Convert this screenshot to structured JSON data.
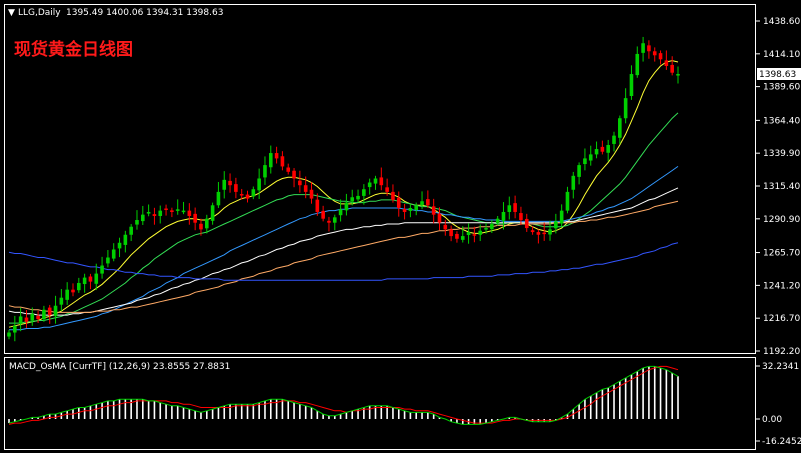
{
  "header": {
    "symbol": "LLG,Daily",
    "ohlc": "1395.49 1400.06 1394.31 1398.63",
    "overlay_title": "现货黄金日线图"
  },
  "macd": {
    "label": "MACD_OsMA [CurrTF] (12,26,9) 23.8555 27.8831",
    "max_label": "32.2341",
    "zero_label": "0.00",
    "min_label": "-16.2452"
  },
  "current_price_label": "1398.63",
  "colors": {
    "background": "#000000",
    "axis": "#ffffff",
    "bull": "#00d000",
    "bear": "#ff0000",
    "title_red": "#ff1a1a",
    "macd_line": "#00d000",
    "signal_line": "#ff0000"
  },
  "chart_data": [
    {
      "type": "candlestick",
      "title": "LLG,Daily",
      "ylim": [
        1192.2,
        1438.6
      ],
      "y_ticks": [
        1438.6,
        1414.1,
        1389.6,
        1364.4,
        1339.9,
        1315.4,
        1290.9,
        1265.7,
        1241.2,
        1216.7,
        1192.2
      ],
      "y_tick_labels": [
        "1438.60",
        "1414.10",
        "1389.60",
        "1364.40",
        "1339.90",
        "1315.40",
        "1290.90",
        "1265.70",
        "1241.20",
        "1216.70",
        "1192.20"
      ],
      "last_close": 1398.63,
      "closes": [
        1206,
        1211,
        1218,
        1214,
        1220,
        1216,
        1223,
        1219,
        1226,
        1232,
        1238,
        1236,
        1243,
        1247,
        1244,
        1250,
        1256,
        1262,
        1268,
        1273,
        1279,
        1285,
        1290,
        1294,
        1296,
        1293,
        1297,
        1298,
        1296,
        1298,
        1297,
        1293,
        1288,
        1283,
        1291,
        1301,
        1311,
        1320,
        1316,
        1311,
        1309,
        1306,
        1313,
        1321,
        1331,
        1340,
        1336,
        1330,
        1326,
        1321,
        1316,
        1311,
        1306,
        1296,
        1291,
        1288,
        1292,
        1298,
        1303,
        1307,
        1308,
        1313,
        1318,
        1321,
        1316,
        1311,
        1305,
        1299,
        1296,
        1299,
        1301,
        1304,
        1301,
        1294,
        1288,
        1283,
        1278,
        1276,
        1278,
        1281,
        1279,
        1282,
        1284,
        1287,
        1291,
        1296,
        1301,
        1296,
        1290,
        1284,
        1281,
        1279,
        1280,
        1283,
        1289,
        1297,
        1311,
        1323,
        1331,
        1336,
        1339,
        1343,
        1341,
        1346,
        1353,
        1366,
        1381,
        1399,
        1414,
        1422,
        1416,
        1413,
        1410,
        1405,
        1400,
        1399
      ],
      "series": [
        {
          "name": "",
          "color": "#ffff33",
          "values": [
            1210,
            1211,
            1212,
            1213,
            1214,
            1215,
            1217,
            1218,
            1220,
            1222,
            1225,
            1228,
            1231,
            1234,
            1236,
            1239,
            1242,
            1246,
            1250,
            1254,
            1259,
            1264,
            1268,
            1272,
            1276,
            1279,
            1282,
            1285,
            1287,
            1289,
            1290,
            1291,
            1291,
            1290,
            1290,
            1292,
            1295,
            1299,
            1302,
            1304,
            1306,
            1307,
            1308,
            1310,
            1313,
            1316,
            1319,
            1321,
            1322,
            1322,
            1321,
            1320,
            1318,
            1315,
            1311,
            1307,
            1304,
            1302,
            1302,
            1302,
            1303,
            1305,
            1307,
            1309,
            1310,
            1310,
            1309,
            1307,
            1304,
            1302,
            1301,
            1301,
            1300,
            1298,
            1295,
            1292,
            1288,
            1285,
            1283,
            1281,
            1280,
            1280,
            1281,
            1282,
            1283,
            1285,
            1287,
            1288,
            1288,
            1287,
            1285,
            1283,
            1282,
            1281,
            1282,
            1284,
            1288,
            1294,
            1301,
            1309,
            1316,
            1323,
            1328,
            1333,
            1339,
            1346,
            1354,
            1364,
            1374,
            1385,
            1394,
            1400,
            1405,
            1408,
            1409,
            1408
          ]
        },
        {
          "name": "",
          "color": "#33dd55",
          "values": [
            1213,
            1213,
            1213,
            1214,
            1214,
            1215,
            1215,
            1216,
            1217,
            1218,
            1220,
            1221,
            1223,
            1225,
            1227,
            1229,
            1231,
            1234,
            1237,
            1240,
            1243,
            1247,
            1250,
            1254,
            1257,
            1261,
            1264,
            1267,
            1270,
            1273,
            1275,
            1277,
            1279,
            1280,
            1281,
            1283,
            1285,
            1287,
            1289,
            1291,
            1293,
            1295,
            1297,
            1299,
            1301,
            1303,
            1305,
            1306,
            1308,
            1309,
            1309,
            1309,
            1309,
            1308,
            1307,
            1306,
            1305,
            1304,
            1304,
            1303,
            1303,
            1303,
            1304,
            1304,
            1305,
            1305,
            1305,
            1304,
            1303,
            1302,
            1301,
            1300,
            1300,
            1299,
            1298,
            1297,
            1295,
            1293,
            1292,
            1291,
            1290,
            1289,
            1288,
            1288,
            1287,
            1287,
            1288,
            1288,
            1288,
            1287,
            1287,
            1286,
            1285,
            1285,
            1285,
            1285,
            1286,
            1288,
            1291,
            1294,
            1297,
            1301,
            1305,
            1309,
            1313,
            1317,
            1322,
            1328,
            1334,
            1340,
            1346,
            1351,
            1356,
            1361,
            1366,
            1370
          ]
        },
        {
          "name": "",
          "color": "#3399ff",
          "values": [
            1208,
            1208,
            1208,
            1209,
            1209,
            1209,
            1210,
            1210,
            1211,
            1212,
            1213,
            1214,
            1215,
            1216,
            1217,
            1218,
            1220,
            1221,
            1223,
            1225,
            1227,
            1229,
            1231,
            1233,
            1236,
            1238,
            1240,
            1243,
            1245,
            1247,
            1250,
            1252,
            1254,
            1256,
            1258,
            1260,
            1262,
            1264,
            1267,
            1269,
            1271,
            1273,
            1275,
            1277,
            1279,
            1281,
            1283,
            1285,
            1287,
            1289,
            1291,
            1292,
            1294,
            1295,
            1296,
            1297,
            1297,
            1298,
            1298,
            1299,
            1299,
            1299,
            1299,
            1299,
            1299,
            1299,
            1299,
            1299,
            1298,
            1298,
            1297,
            1297,
            1296,
            1296,
            1295,
            1294,
            1294,
            1293,
            1292,
            1292,
            1291,
            1291,
            1290,
            1290,
            1290,
            1289,
            1289,
            1289,
            1289,
            1289,
            1289,
            1289,
            1289,
            1289,
            1289,
            1289,
            1290,
            1291,
            1292,
            1293,
            1294,
            1296,
            1297,
            1299,
            1300,
            1302,
            1304,
            1306,
            1309,
            1312,
            1315,
            1318,
            1321,
            1324,
            1327,
            1330
          ]
        },
        {
          "name": "",
          "color": "#ffffff",
          "values": [
            1222,
            1221,
            1221,
            1220,
            1220,
            1219,
            1219,
            1219,
            1219,
            1219,
            1219,
            1220,
            1220,
            1221,
            1221,
            1222,
            1223,
            1224,
            1225,
            1226,
            1227,
            1228,
            1230,
            1231,
            1232,
            1234,
            1235,
            1237,
            1239,
            1240,
            1242,
            1243,
            1245,
            1246,
            1248,
            1250,
            1251,
            1253,
            1254,
            1256,
            1258,
            1259,
            1261,
            1263,
            1264,
            1266,
            1268,
            1269,
            1271,
            1272,
            1274,
            1275,
            1276,
            1278,
            1279,
            1280,
            1281,
            1282,
            1283,
            1283,
            1284,
            1285,
            1285,
            1286,
            1286,
            1287,
            1287,
            1287,
            1288,
            1288,
            1288,
            1288,
            1288,
            1288,
            1288,
            1288,
            1288,
            1288,
            1288,
            1288,
            1288,
            1288,
            1288,
            1288,
            1288,
            1288,
            1288,
            1288,
            1288,
            1288,
            1288,
            1288,
            1288,
            1288,
            1288,
            1288,
            1289,
            1289,
            1290,
            1291,
            1292,
            1293,
            1294,
            1295,
            1296,
            1297,
            1298,
            1299,
            1301,
            1303,
            1305,
            1306,
            1308,
            1310,
            1312,
            1314
          ]
        },
        {
          "name": "",
          "color": "#ffaa66",
          "values": [
            1226,
            1225,
            1225,
            1224,
            1223,
            1223,
            1222,
            1222,
            1221,
            1221,
            1221,
            1221,
            1221,
            1221,
            1221,
            1222,
            1222,
            1222,
            1223,
            1223,
            1224,
            1225,
            1225,
            1226,
            1227,
            1228,
            1229,
            1230,
            1231,
            1232,
            1233,
            1234,
            1236,
            1237,
            1238,
            1239,
            1240,
            1242,
            1243,
            1244,
            1246,
            1247,
            1248,
            1250,
            1251,
            1252,
            1254,
            1255,
            1256,
            1258,
            1259,
            1260,
            1261,
            1263,
            1264,
            1265,
            1266,
            1267,
            1268,
            1269,
            1270,
            1271,
            1272,
            1273,
            1274,
            1275,
            1276,
            1277,
            1277,
            1278,
            1279,
            1280,
            1280,
            1281,
            1282,
            1282,
            1283,
            1283,
            1284,
            1284,
            1284,
            1285,
            1285,
            1285,
            1286,
            1286,
            1286,
            1286,
            1287,
            1287,
            1287,
            1287,
            1287,
            1287,
            1288,
            1288,
            1288,
            1288,
            1289,
            1289,
            1290,
            1290,
            1291,
            1292,
            1292,
            1293,
            1294,
            1295,
            1296,
            1297,
            1298,
            1300,
            1301,
            1302,
            1303,
            1304
          ]
        },
        {
          "name": "",
          "color": "#3355ff",
          "values": [
            1266,
            1265,
            1265,
            1264,
            1263,
            1262,
            1262,
            1261,
            1260,
            1259,
            1258,
            1258,
            1257,
            1256,
            1255,
            1255,
            1254,
            1253,
            1253,
            1252,
            1251,
            1251,
            1250,
            1250,
            1249,
            1249,
            1248,
            1248,
            1248,
            1247,
            1247,
            1247,
            1246,
            1246,
            1246,
            1246,
            1246,
            1245,
            1245,
            1245,
            1245,
            1245,
            1245,
            1245,
            1245,
            1245,
            1245,
            1245,
            1245,
            1245,
            1245,
            1245,
            1245,
            1245,
            1245,
            1245,
            1245,
            1245,
            1245,
            1245,
            1245,
            1245,
            1245,
            1245,
            1245,
            1246,
            1246,
            1246,
            1246,
            1246,
            1246,
            1246,
            1246,
            1247,
            1247,
            1247,
            1247,
            1247,
            1247,
            1248,
            1248,
            1248,
            1248,
            1248,
            1249,
            1249,
            1249,
            1250,
            1250,
            1250,
            1251,
            1251,
            1251,
            1252,
            1252,
            1253,
            1253,
            1254,
            1254,
            1255,
            1256,
            1257,
            1257,
            1258,
            1259,
            1260,
            1261,
            1262,
            1263,
            1265,
            1266,
            1267,
            1269,
            1270,
            1272,
            1273
          ]
        }
      ]
    },
    {
      "type": "histogram+line",
      "title": "MACD_OsMA [CurrTF] (12,26,9) 23.8555 27.8831",
      "ylim": [
        -16.2452,
        32.2341
      ],
      "macd": [
        -3,
        -2,
        -1,
        0,
        1,
        1,
        2,
        3,
        3,
        4,
        5,
        6,
        7,
        7,
        8,
        9,
        10,
        11,
        11,
        12,
        12,
        12,
        12,
        12,
        11,
        11,
        10,
        9,
        8,
        8,
        7,
        6,
        5,
        4,
        5,
        6,
        7,
        8,
        9,
        9,
        9,
        9,
        9,
        10,
        11,
        12,
        12,
        12,
        11,
        10,
        9,
        8,
        7,
        5,
        3,
        2,
        2,
        3,
        4,
        5,
        6,
        7,
        8,
        8,
        8,
        8,
        7,
        6,
        5,
        4,
        4,
        4,
        4,
        3,
        1,
        0,
        -2,
        -3,
        -4,
        -4,
        -4,
        -4,
        -3,
        -2,
        -1,
        0,
        1,
        1,
        0,
        -1,
        -2,
        -2,
        -2,
        -2,
        -1,
        1,
        3,
        6,
        9,
        12,
        14,
        16,
        18,
        19,
        21,
        23,
        25,
        27,
        29,
        31,
        32,
        32,
        31,
        30,
        28,
        26
      ],
      "signal": [
        -4,
        -3,
        -3,
        -2,
        -1,
        -1,
        0,
        1,
        1,
        2,
        3,
        3,
        4,
        5,
        5,
        6,
        7,
        8,
        8,
        9,
        10,
        10,
        11,
        11,
        11,
        11,
        11,
        11,
        10,
        10,
        9,
        9,
        8,
        7,
        7,
        7,
        7,
        7,
        7,
        8,
        8,
        8,
        8,
        9,
        9,
        10,
        10,
        11,
        11,
        11,
        10,
        10,
        9,
        8,
        7,
        6,
        5,
        5,
        4,
        5,
        5,
        6,
        6,
        7,
        7,
        7,
        7,
        7,
        6,
        6,
        5,
        5,
        5,
        4,
        3,
        2,
        1,
        0,
        -1,
        -2,
        -3,
        -3,
        -3,
        -3,
        -2,
        -1,
        -1,
        0,
        0,
        -1,
        -1,
        -1,
        -1,
        -1,
        -1,
        0,
        1,
        3,
        5,
        7,
        9,
        12,
        14,
        16,
        18,
        20,
        22,
        24,
        26,
        28,
        30,
        31,
        32,
        32,
        31,
        30
      ]
    }
  ]
}
